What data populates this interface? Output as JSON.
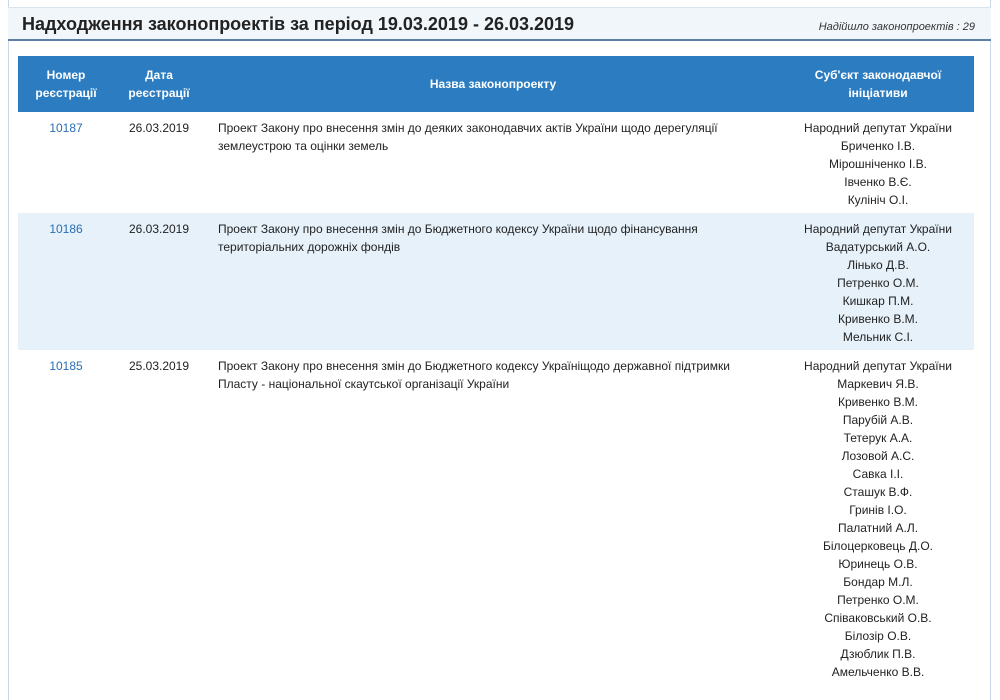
{
  "header": {
    "title": "Надходження законопроектів за період 19.03.2019 - 26.03.2019",
    "count_label": "Надійшло законопроектів : 29"
  },
  "table": {
    "columns": {
      "number": "Номер реєстрації",
      "date": "Дата реєстрації",
      "name": "Назва законопроекту",
      "subject": "Суб'єкт законодавчої ініціативи"
    },
    "rows": [
      {
        "number": "10187",
        "date": "26.03.2019",
        "title": "Проект Закону про внесення змін до деяких законодавчих актів України щодо дерегуляції землеустрою та оцінки земель",
        "authors": [
          "Народний депутат України",
          "Бриченко І.В.",
          "Мірошніченко І.В.",
          "Івченко В.Є.",
          "Кулініч О.І."
        ]
      },
      {
        "number": "10186",
        "date": "26.03.2019",
        "title": "Проект Закону про внесення змін до Бюджетного кодексу України щодо фінансування територіальних дорожніх фондів",
        "authors": [
          "Народний депутат України",
          "Вадатурський А.О.",
          "Лінько Д.В.",
          "Петренко О.М.",
          "Кишкар П.М.",
          "Кривенко В.М.",
          "Мельник С.І."
        ]
      },
      {
        "number": "10185",
        "date": "25.03.2019",
        "title": "Проект Закону про внесення змін до Бюджетного кодексу Україніщодо державної підтримки Пласту - національної скаутської організації України",
        "authors": [
          "Народний депутат України",
          "Маркевич Я.В.",
          "Кривенко В.М.",
          "Парубій А.В.",
          "Тетерук А.А.",
          "Лозовой А.С.",
          "Савка І.І.",
          "Сташук В.Ф.",
          "Гринів І.О.",
          "Палатний А.Л.",
          "Білоцерковець Д.О.",
          "Юринець О.В.",
          "Бондар М.Л.",
          "Петренко О.М.",
          "Співаковський О.В.",
          "Білозір О.В.",
          "Дзюблик П.В.",
          "Амельченко В.В."
        ]
      }
    ]
  }
}
